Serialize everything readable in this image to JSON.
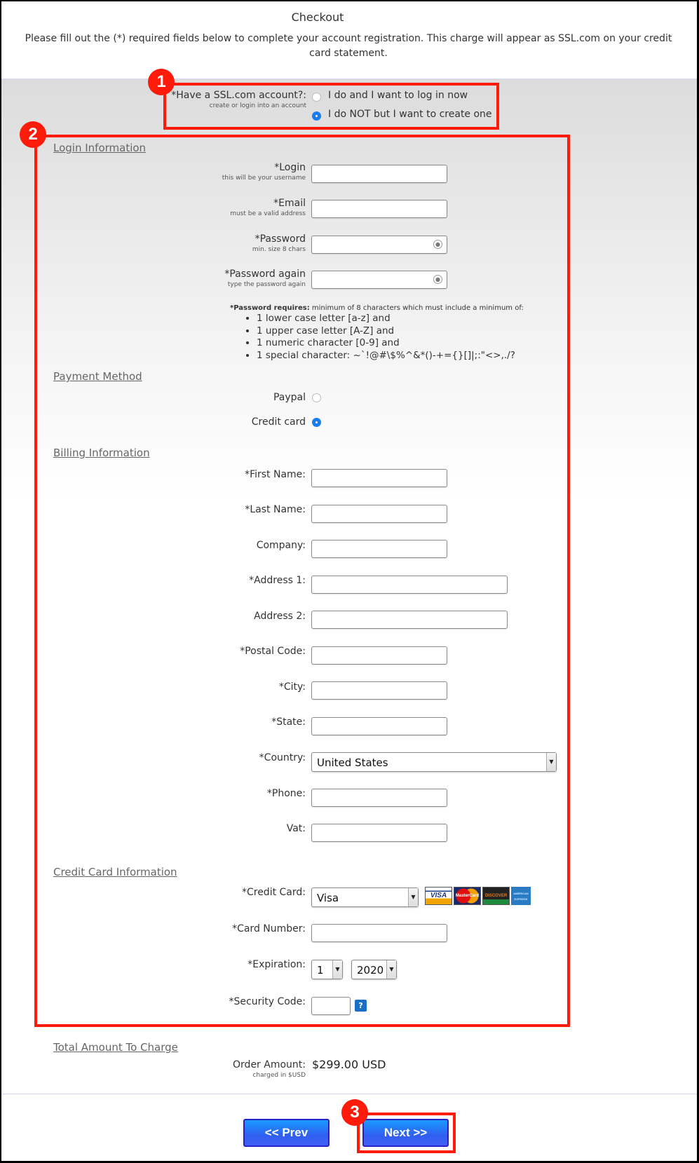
{
  "header": {
    "title": "Checkout",
    "intro": "Please fill out the (*) required fields below to complete your account registration. This charge will appear as SSL.com on your credit card statement."
  },
  "account": {
    "label": "*Have a SSL.com account?:",
    "sublabel": "create or login into an account",
    "options": [
      {
        "label": "I do and I want to log in now",
        "selected": false
      },
      {
        "label": "I do NOT but I want to create one",
        "selected": true
      }
    ]
  },
  "annotations": [
    "1",
    "2",
    "3"
  ],
  "login": {
    "heading": "Login Information",
    "fields": [
      {
        "label": "*Login",
        "hint": "this will be your username",
        "value": ""
      },
      {
        "label": "*Email",
        "hint": "must be a valid address",
        "value": ""
      },
      {
        "label": "*Password",
        "hint": "min. size 8 chars",
        "value": ""
      },
      {
        "label": "*Password again",
        "hint": "type the password again",
        "value": ""
      }
    ],
    "password_requires_bold": "*Password requires:",
    "password_requires_text": " minimum of 8 characters which must include a minimum of:",
    "requirements": [
      "1 lower case letter [a-z] and",
      "1 upper case letter [A-Z] and",
      "1 numeric character [0-9] and",
      "1 special character: ~`!@#\\$%^&*()-+={}[]|;:\"<>,./?"
    ]
  },
  "payment": {
    "heading": "Payment Method",
    "options": [
      {
        "label": "Paypal",
        "selected": false
      },
      {
        "label": "Credit card",
        "selected": true
      }
    ]
  },
  "billing": {
    "heading": "Billing Information",
    "fields": [
      {
        "label": "*First Name:",
        "value": ""
      },
      {
        "label": "*Last Name:",
        "value": ""
      },
      {
        "label": "Company:",
        "value": ""
      },
      {
        "label": "*Address 1:",
        "value": ""
      },
      {
        "label": "Address 2:",
        "value": ""
      },
      {
        "label": "*Postal Code:",
        "value": ""
      },
      {
        "label": "*City:",
        "value": ""
      },
      {
        "label": "*State:",
        "value": ""
      },
      {
        "label": "*Country:",
        "value": "United States"
      },
      {
        "label": "*Phone:",
        "value": ""
      },
      {
        "label": "Vat:",
        "value": ""
      }
    ]
  },
  "credit_card": {
    "heading": "Credit Card Information",
    "card_label": "*Credit Card:",
    "card_value": "Visa",
    "card_logos": [
      "VISA",
      "MasterCard",
      "DISCOVER",
      "AMERICAN EXPRESS"
    ],
    "number_label": "*Card Number:",
    "number_value": "",
    "expiration_label": "*Expiration:",
    "exp_month": "1",
    "exp_year": "2020",
    "security_label": "*Security Code:",
    "security_value": "",
    "help_icon": "?"
  },
  "total": {
    "heading": "Total Amount To Charge",
    "label": "Order Amount:",
    "sublabel": "charged in $USD",
    "amount": "$299.00 USD"
  },
  "nav": {
    "prev_label": "<< Prev",
    "next_label": "Next >>"
  },
  "colors": {
    "annotation_red": "#ff1a0a",
    "radio_selected": "#1a7cf5",
    "button_blue": "#2f5ff0"
  }
}
